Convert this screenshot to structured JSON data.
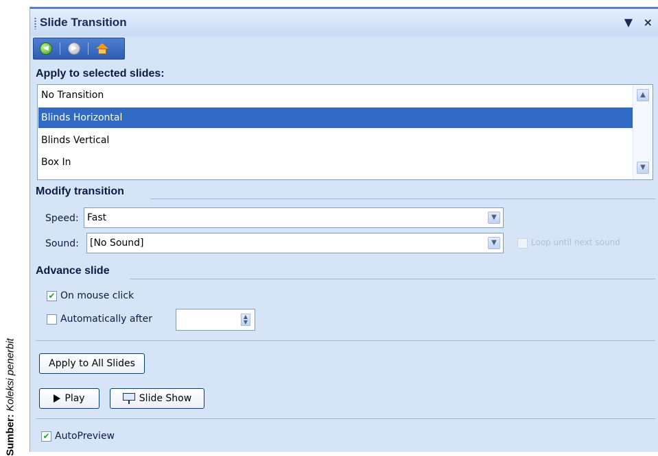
{
  "caption": {
    "source_label": "Sumber:",
    "source_value": "Koleksi penerbit"
  },
  "pane": {
    "title": "Slide Transition",
    "dropdown_glyph": "▼",
    "close_glyph": "×",
    "nav": {
      "back_icon": "back-arrow-icon",
      "forward_icon": "forward-arrow-icon",
      "home_icon": "home-icon"
    }
  },
  "apply_section": {
    "title": "Apply to selected slides:",
    "items": [
      "No Transition",
      "Blinds Horizontal",
      "Blinds Vertical",
      "Box In"
    ],
    "selected_index": 1
  },
  "modify_section": {
    "title": "Modify transition",
    "speed_label": "Speed:",
    "speed_value": "Fast",
    "sound_label": "Sound:",
    "sound_value": "[No Sound]",
    "loop_label": "Loop until next sound"
  },
  "advance_section": {
    "title": "Advance slide",
    "on_mouse_click_label": "On mouse click",
    "on_mouse_click_checked": true,
    "auto_after_label": "Automatically after",
    "auto_after_checked": false,
    "auto_after_value": ""
  },
  "buttons": {
    "apply_all": "Apply to All Slides",
    "play": "Play",
    "slide_show": "Slide Show"
  },
  "autopreview": {
    "label": "AutoPreview",
    "checked": true
  },
  "colors": {
    "pane_bg": "#d6e4f7",
    "selection": "#316ac5",
    "check_mark": "#22a12b"
  }
}
